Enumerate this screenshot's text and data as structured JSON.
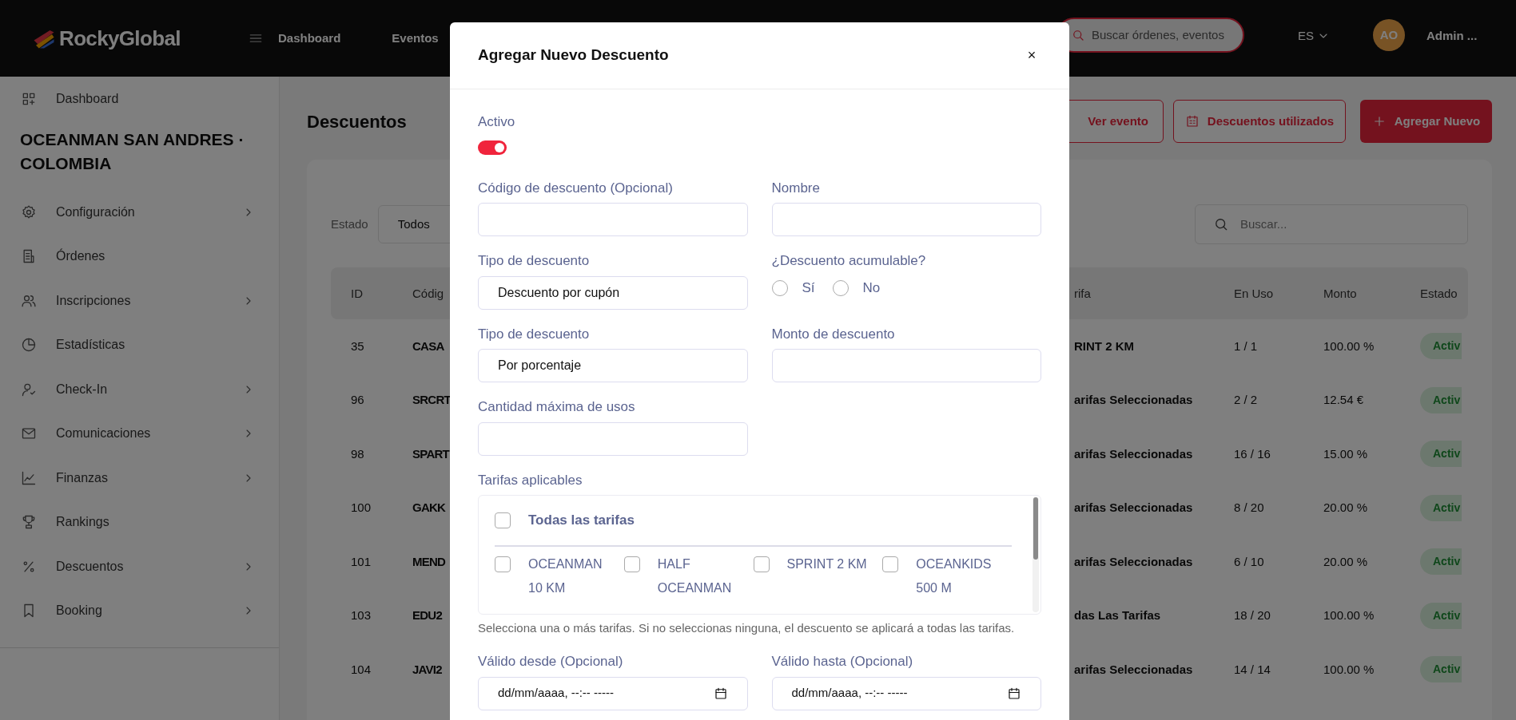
{
  "topbar": {
    "logo": "RockyGlobal",
    "nav": [
      "Dashboard",
      "Eventos"
    ],
    "search_placeholder": "Buscar órdenes, eventos",
    "language": "ES",
    "avatar": "AO",
    "user": "Admin ..."
  },
  "sidebar": {
    "top_item": "Dashboard",
    "event_title": "OCEANMAN SAN ANDRES · COLOMBIA",
    "items": [
      {
        "label": "Configuración",
        "has_children": true
      },
      {
        "label": "Órdenes",
        "has_children": false
      },
      {
        "label": "Inscripciones",
        "has_children": true
      },
      {
        "label": "Estadísticas",
        "has_children": false
      },
      {
        "label": "Check-In",
        "has_children": true
      },
      {
        "label": "Comunicaciones",
        "has_children": true
      },
      {
        "label": "Finanzas",
        "has_children": true
      },
      {
        "label": "Rankings",
        "has_children": false
      },
      {
        "label": "Descuentos",
        "has_children": true
      },
      {
        "label": "Booking",
        "has_children": true
      }
    ]
  },
  "page": {
    "title": "Descuentos",
    "buttons": [
      {
        "label": "Ver evento",
        "kind": "outline"
      },
      {
        "label": "Descuentos utilizados",
        "kind": "outline_icon"
      },
      {
        "label": "Agregar Nuevo",
        "kind": "primary"
      }
    ],
    "filter": {
      "label": "Estado",
      "value": "Todos"
    },
    "search": {
      "placeholder": "Buscar..."
    },
    "table": {
      "columns": [
        "ID",
        "Códig",
        "rifa",
        "En Uso",
        "Monto",
        "Estado"
      ],
      "rows": [
        [
          "35",
          "CASA",
          "RINT 2 KM",
          "1 / 1",
          "100.00 %",
          "Activ"
        ],
        [
          "96",
          "SRCRT",
          "arifas Seleccionadas",
          "2 / 2",
          "12.54 €",
          "Activ"
        ],
        [
          "98",
          "SPART",
          "arifas Seleccionadas",
          "16 / 16",
          "15.00 %",
          "Activ"
        ],
        [
          "100",
          "GAKK",
          "arifas Seleccionadas",
          "8 / 20",
          "20.00 %",
          "Activ"
        ],
        [
          "101",
          "MEND",
          "arifas Seleccionadas",
          "6 / 10",
          "20.00 %",
          "Activ"
        ],
        [
          "103",
          "EDU2",
          "das Las Tarifas",
          "18 / 20",
          "100.00 %",
          "Activ"
        ],
        [
          "104",
          "JAVI2",
          "arifas Seleccionadas",
          "14 / 14",
          "100.00 %",
          "Activ"
        ]
      ]
    }
  },
  "modal": {
    "title": "Agregar Nuevo Descuento",
    "close": "×",
    "fields": [
      {
        "kind": "toggle",
        "label": "Activo",
        "on": true
      },
      {
        "kind": "text",
        "label": "Código de descuento (Opcional)"
      },
      {
        "kind": "text",
        "label": "Nombre"
      },
      {
        "kind": "select",
        "label": "Tipo de descuento",
        "value": "Descuento por cupón"
      },
      {
        "kind": "radio",
        "label": "¿Descuento acumulable?",
        "options": [
          {
            "label": "Sí",
            "selected": false
          },
          {
            "label": "No",
            "selected": false
          }
        ]
      },
      {
        "kind": "select",
        "label": "Tipo de descuento",
        "value": "Por porcentaje"
      },
      {
        "kind": "text",
        "label": "Monto de descuento"
      },
      {
        "kind": "text",
        "label": "Cantidad máxima de usos"
      },
      {
        "kind": "checklist",
        "label": "Tarifas aplicables",
        "all": {
          "label": "Todas las tarifas",
          "checked": false
        },
        "options": [
          {
            "label": "OCEANMAN 10 KM",
            "checked": false
          },
          {
            "label": "HALF OCEANMAN",
            "checked": false
          },
          {
            "label": "SPRINT 2 KM",
            "checked": false
          },
          {
            "label": "OCEANKIDS 500 M",
            "checked": false
          }
        ],
        "help": "Selecciona una o más tarifas. Si no seleccionas ninguna, el descuento se aplicará a todas las tarifas."
      },
      {
        "kind": "date",
        "label": "Válido desde (Opcional)",
        "placeholder": "dd/mm/aaaa, --:-- -----"
      },
      {
        "kind": "date",
        "label": "Válido hasta (Opcional)",
        "placeholder": "dd/mm/aaaa, --:-- -----"
      }
    ]
  }
}
